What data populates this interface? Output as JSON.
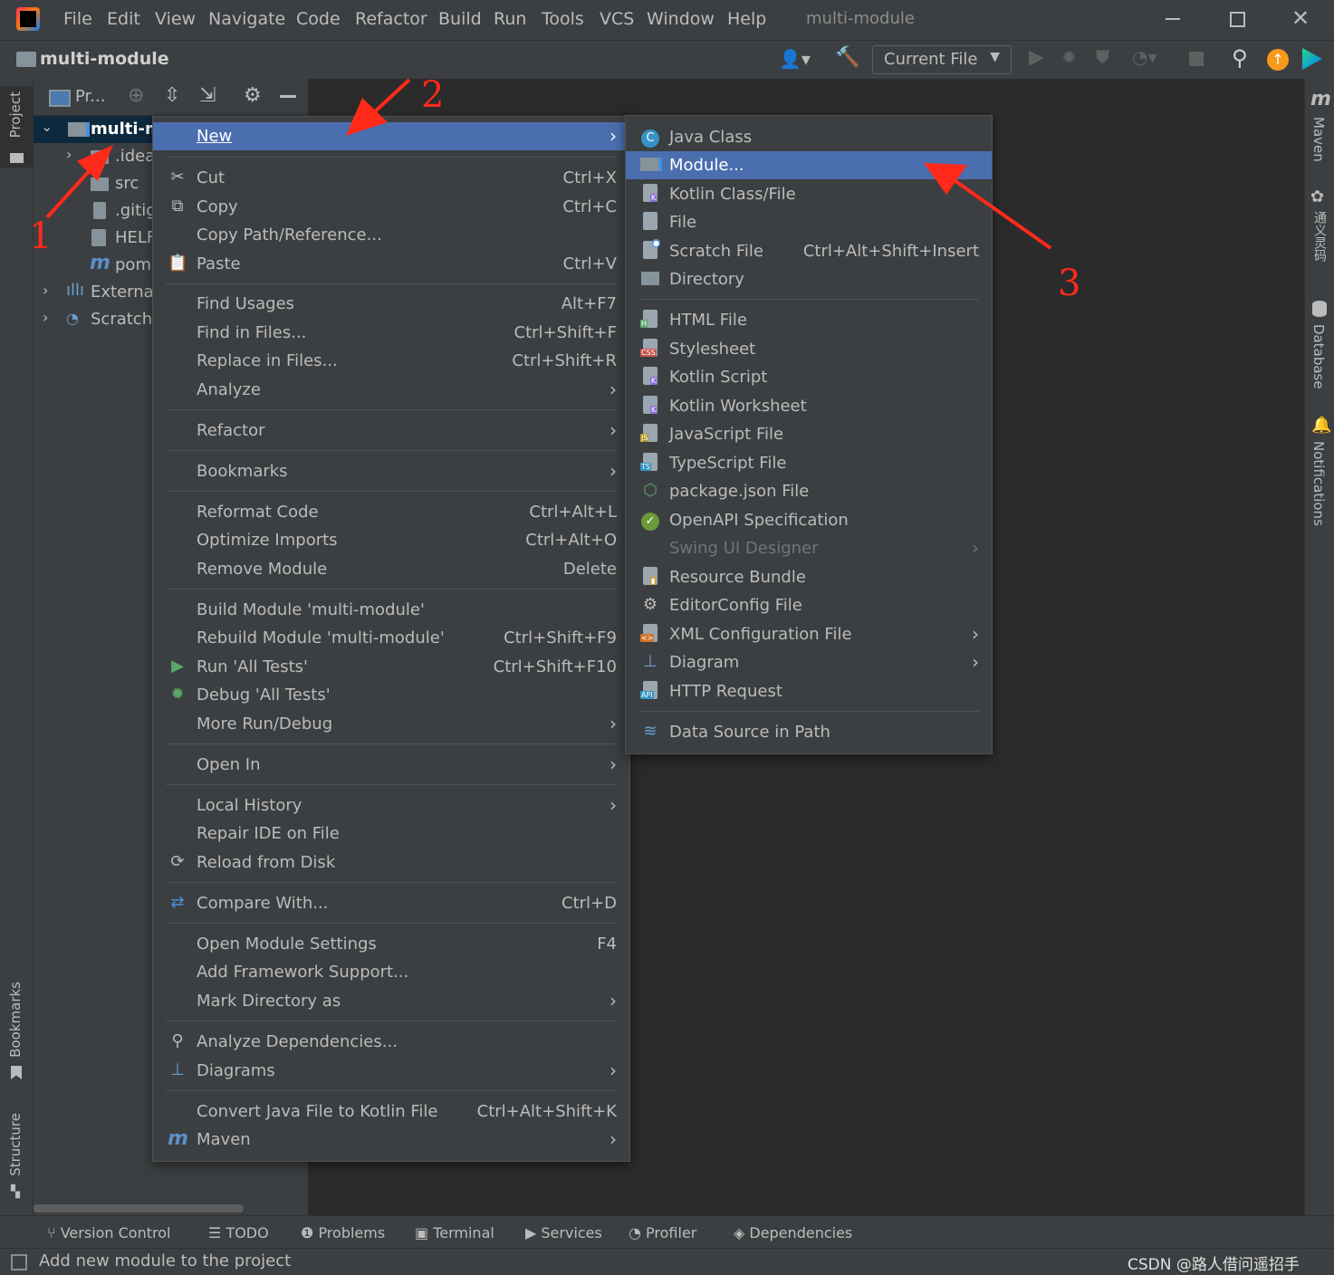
{
  "titlebar": {
    "menus": [
      "File",
      "Edit",
      "View",
      "Navigate",
      "Code",
      "Refactor",
      "Build",
      "Run",
      "Tools",
      "VCS",
      "Window",
      "Help"
    ],
    "window_title": "multi-module"
  },
  "navbar": {
    "project_name": "multi-module",
    "run_config": "Current File"
  },
  "left_stripe": {
    "project": "Project",
    "bookmarks": "Bookmarks",
    "structure": "Structure"
  },
  "right_stripe": {
    "maven": "Maven",
    "tongyi": "通义灵码",
    "database": "Database",
    "notifications": "Notifications"
  },
  "project_panel": {
    "header_label": "Pr...",
    "tree": [
      {
        "label": "multi-m",
        "bold": true
      },
      {
        "label": ".idea"
      },
      {
        "label": "src"
      },
      {
        "label": ".gitig"
      },
      {
        "label": "HELF"
      },
      {
        "label": "pom"
      },
      {
        "label": "External"
      },
      {
        "label": "Scratche"
      }
    ]
  },
  "context_menu": {
    "items": [
      {
        "label": "New",
        "arrow": true
      },
      {
        "label": "Cut",
        "shortcut": "Ctrl+X"
      },
      {
        "label": "Copy",
        "shortcut": "Ctrl+C"
      },
      {
        "label": "Copy Path/Reference..."
      },
      {
        "label": "Paste",
        "shortcut": "Ctrl+V"
      },
      {
        "label": "Find Usages",
        "shortcut": "Alt+F7"
      },
      {
        "label": "Find in Files...",
        "shortcut": "Ctrl+Shift+F"
      },
      {
        "label": "Replace in Files...",
        "shortcut": "Ctrl+Shift+R"
      },
      {
        "label": "Analyze",
        "arrow": true
      },
      {
        "label": "Refactor",
        "arrow": true
      },
      {
        "label": "Bookmarks",
        "arrow": true
      },
      {
        "label": "Reformat Code",
        "shortcut": "Ctrl+Alt+L"
      },
      {
        "label": "Optimize Imports",
        "shortcut": "Ctrl+Alt+O"
      },
      {
        "label": "Remove Module",
        "shortcut": "Delete"
      },
      {
        "label": "Build Module 'multi-module'"
      },
      {
        "label": "Rebuild Module 'multi-module'",
        "shortcut": "Ctrl+Shift+F9"
      },
      {
        "label": "Run 'All Tests'",
        "shortcut": "Ctrl+Shift+F10"
      },
      {
        "label": "Debug 'All Tests'"
      },
      {
        "label": "More Run/Debug",
        "arrow": true
      },
      {
        "label": "Open In",
        "arrow": true
      },
      {
        "label": "Local History",
        "arrow": true
      },
      {
        "label": "Repair IDE on File"
      },
      {
        "label": "Reload from Disk"
      },
      {
        "label": "Compare With...",
        "shortcut": "Ctrl+D"
      },
      {
        "label": "Open Module Settings",
        "shortcut": "F4"
      },
      {
        "label": "Add Framework Support..."
      },
      {
        "label": "Mark Directory as",
        "arrow": true
      },
      {
        "label": "Analyze Dependencies..."
      },
      {
        "label": "Diagrams",
        "arrow": true
      },
      {
        "label": "Convert Java File to Kotlin File",
        "shortcut": "Ctrl+Alt+Shift+K"
      },
      {
        "label": "Maven",
        "arrow": true
      }
    ]
  },
  "new_submenu": {
    "items": [
      {
        "label": "Java Class"
      },
      {
        "label": "Module..."
      },
      {
        "label": "Kotlin Class/File"
      },
      {
        "label": "File"
      },
      {
        "label": "Scratch File",
        "shortcut": "Ctrl+Alt+Shift+Insert"
      },
      {
        "label": "Directory"
      },
      {
        "label": "HTML File"
      },
      {
        "label": "Stylesheet"
      },
      {
        "label": "Kotlin Script"
      },
      {
        "label": "Kotlin Worksheet"
      },
      {
        "label": "JavaScript File"
      },
      {
        "label": "TypeScript File"
      },
      {
        "label": "package.json File"
      },
      {
        "label": "OpenAPI Specification"
      },
      {
        "label": "Swing UI Designer",
        "arrow": true,
        "disabled": true
      },
      {
        "label": "Resource Bundle"
      },
      {
        "label": "EditorConfig File"
      },
      {
        "label": "XML Configuration File",
        "arrow": true
      },
      {
        "label": "Diagram",
        "arrow": true
      },
      {
        "label": "HTTP Request"
      },
      {
        "label": "Data Source in Path"
      }
    ]
  },
  "bottom_tools": [
    "Version Control",
    "TODO",
    "Problems",
    "Terminal",
    "Services",
    "Profiler",
    "Dependencies"
  ],
  "status": {
    "message": "Add new module to the project",
    "watermark": "CSDN @路人借问遥招手"
  },
  "annotations": {
    "step1": "1",
    "step2": "2",
    "step3": "3"
  },
  "colors": {
    "selection": "#4b6eaf",
    "panel": "#3c3f41",
    "editor": "#2b2b2b",
    "arrow": "#ff2a1a"
  }
}
